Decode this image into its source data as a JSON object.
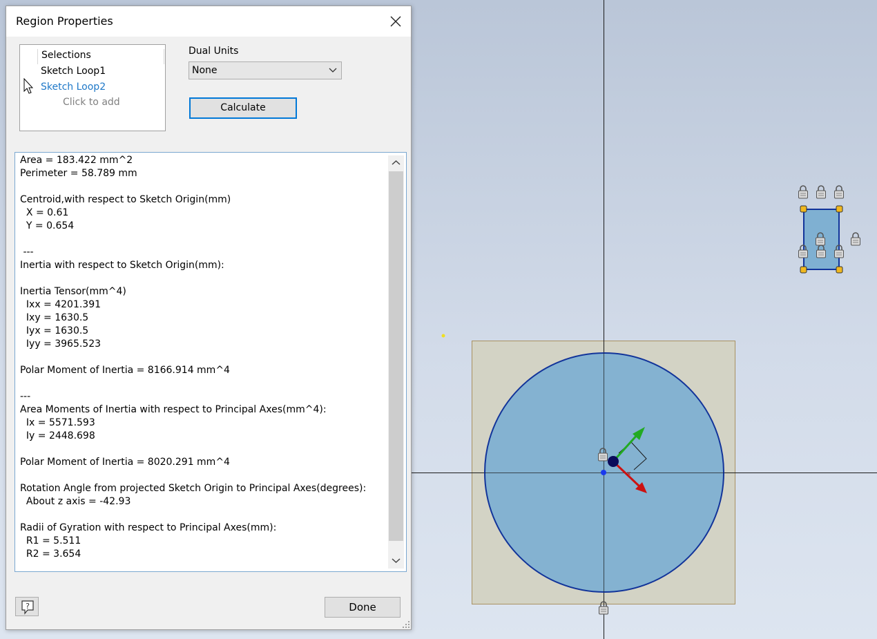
{
  "dialog": {
    "title": "Region Properties",
    "selections": {
      "header": "Selections",
      "items": [
        "Sketch Loop1",
        "Sketch Loop2"
      ],
      "add_hint": "Click to add"
    },
    "dual_units": {
      "label": "Dual Units",
      "selected": "None"
    },
    "calculate_label": "Calculate",
    "results_lines": [
      "Area = 183.422 mm^2",
      "Perimeter = 58.789 mm",
      "",
      "Centroid,with respect to Sketch Origin(mm)",
      "  X = 0.61",
      "  Y = 0.654",
      "",
      " ---",
      "Inertia with respect to Sketch Origin(mm):",
      "",
      "Inertia Tensor(mm^4)",
      "  Ixx = 4201.391",
      "  Ixy = 1630.5",
      "  Iyx = 1630.5",
      "  Iyy = 3965.523",
      "",
      "Polar Moment of Inertia = 8166.914 mm^4",
      "",
      "---",
      "Area Moments of Inertia with respect to Principal Axes(mm^4):",
      "  Ix = 5571.593",
      "  Iy = 2448.698",
      "",
      "Polar Moment of Inertia = 8020.291 mm^4",
      "",
      "Rotation Angle from projected Sketch Origin to Principal Axes(degrees):",
      "  About z axis = -42.93",
      "",
      "Radii of Gyration with respect to Principal Axes(mm):",
      "  R1 = 5.511",
      "  R2 = 3.654"
    ],
    "done_label": "Done"
  },
  "canvas": {
    "colors": {
      "square_fill": "#d3d3c5",
      "square_border": "#a89060",
      "circle_fill": "#7fb0d2",
      "circle_stroke": "#12349a",
      "selection_accent": "#1e78c8"
    }
  }
}
